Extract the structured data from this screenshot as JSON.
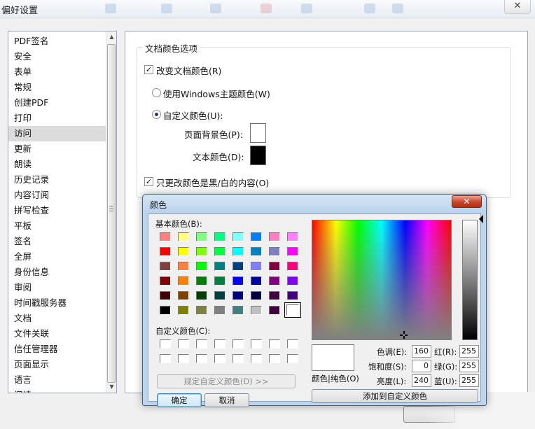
{
  "window": {
    "title": "偏好设置",
    "close_glyph": "✕"
  },
  "categories": [
    {
      "label": "PDF签名"
    },
    {
      "label": "安全"
    },
    {
      "label": "表单"
    },
    {
      "label": "常规"
    },
    {
      "label": "创建PDF"
    },
    {
      "label": "打印"
    },
    {
      "label": "访问",
      "selected": true
    },
    {
      "label": "更新"
    },
    {
      "label": "朗读"
    },
    {
      "label": "历史记录"
    },
    {
      "label": "内容订阅"
    },
    {
      "label": "拼写检查"
    },
    {
      "label": "平板"
    },
    {
      "label": "签名"
    },
    {
      "label": "全屏"
    },
    {
      "label": "身份信息"
    },
    {
      "label": "审阅"
    },
    {
      "label": "时间戳服务器"
    },
    {
      "label": "文档"
    },
    {
      "label": "文件关联"
    },
    {
      "label": "信任管理器"
    },
    {
      "label": "页面显示"
    },
    {
      "label": "语言"
    },
    {
      "label": "阅读"
    }
  ],
  "doc_colors": {
    "legend": "文档颜色选项",
    "change_colors": {
      "label": "改变文档颜色(R)",
      "checked": true
    },
    "use_windows": {
      "label": "使用Windows主题颜色(W)",
      "selected": false
    },
    "custom": {
      "label": "自定义颜色(U):",
      "selected": true
    },
    "page_bg": {
      "label": "页面背景色(P):",
      "color": "#ffffff"
    },
    "text_color": {
      "label": "文本颜色(D):",
      "color": "#000000"
    },
    "only_bw": {
      "label": "只更改颜色是黑/白的内容(O)",
      "checked": true
    }
  },
  "bg_buttons": {
    "ok": "",
    "cancel": "取消"
  },
  "color_dialog": {
    "title": "颜色",
    "close_glyph": "✕",
    "basic_label": "基本颜色(B):",
    "basic_colors": [
      [
        "#ff8080",
        "#ffff80",
        "#80ff80",
        "#00ff80",
        "#80ffff",
        "#0080ff",
        "#ff80c0",
        "#ff80ff"
      ],
      [
        "#ff0000",
        "#ffff00",
        "#80ff00",
        "#00ff40",
        "#00ffff",
        "#0080c0",
        "#8080c0",
        "#ff00ff"
      ],
      [
        "#804040",
        "#ff8040",
        "#00ff00",
        "#008080",
        "#004080",
        "#8080ff",
        "#800040",
        "#ff0080"
      ],
      [
        "#800000",
        "#ff8000",
        "#008000",
        "#008040",
        "#0000ff",
        "#0000a0",
        "#800080",
        "#8000ff"
      ],
      [
        "#400000",
        "#804000",
        "#004000",
        "#004040",
        "#000080",
        "#000040",
        "#400040",
        "#400080"
      ],
      [
        "#000000",
        "#808000",
        "#808040",
        "#808080",
        "#408080",
        "#c0c0c0",
        "#400040",
        "#ffffff"
      ]
    ],
    "selected_basic": [
      5,
      7
    ],
    "custom_label": "自定义颜色(C):",
    "define_custom_button": "规定自定义颜色(D) >>",
    "ok_button": "确定",
    "cancel_button": "取消",
    "color_solid_label": "颜色|纯色(O)",
    "hue": {
      "label": "色调(E):",
      "value": "160"
    },
    "sat": {
      "label": "饱和度(S):",
      "value": "0"
    },
    "lum": {
      "label": "亮度(L):",
      "value": "240"
    },
    "red": {
      "label": "红(R):",
      "value": "255"
    },
    "green": {
      "label": "绿(G):",
      "value": "255"
    },
    "blue": {
      "label": "蓝(U):",
      "value": "255"
    },
    "add_custom_button": "添加到自定义颜色",
    "preview_color": "#ffffff"
  }
}
